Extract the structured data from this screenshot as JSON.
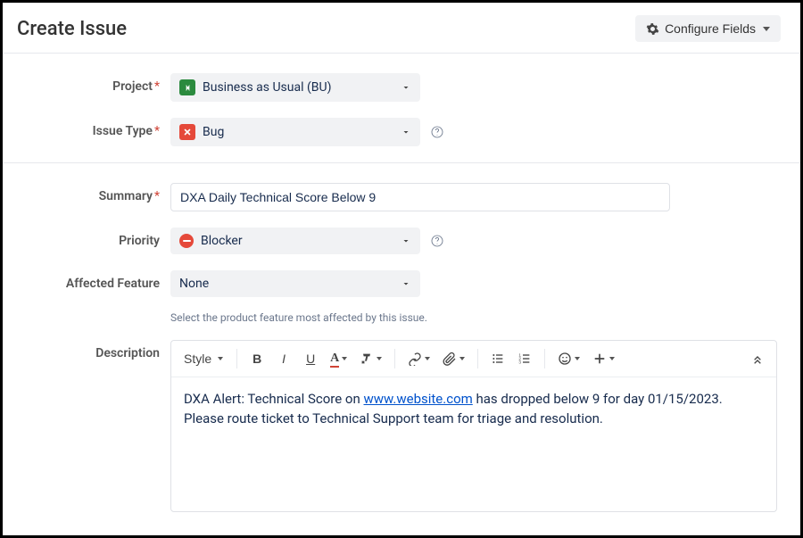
{
  "header": {
    "title": "Create Issue",
    "configure_label": "Configure Fields"
  },
  "fields": {
    "project": {
      "label": "Project",
      "required": true,
      "value": "Business as Usual (BU)"
    },
    "issue_type": {
      "label": "Issue Type",
      "required": true,
      "value": "Bug"
    },
    "summary": {
      "label": "Summary",
      "required": true,
      "value": "DXA Daily Technical Score Below 9"
    },
    "priority": {
      "label": "Priority",
      "required": false,
      "value": "Blocker"
    },
    "affected_feature": {
      "label": "Affected Feature",
      "required": false,
      "value": "None",
      "hint": "Select the product feature most affected by this issue."
    },
    "description": {
      "label": "Description",
      "style_label": "Style",
      "body_before": "DXA Alert: Technical Score on ",
      "body_link": "www.website.com",
      "body_after": " has dropped below 9 for day 01/15/2023. Please route ticket to Technical Support team for triage and resolution."
    }
  }
}
